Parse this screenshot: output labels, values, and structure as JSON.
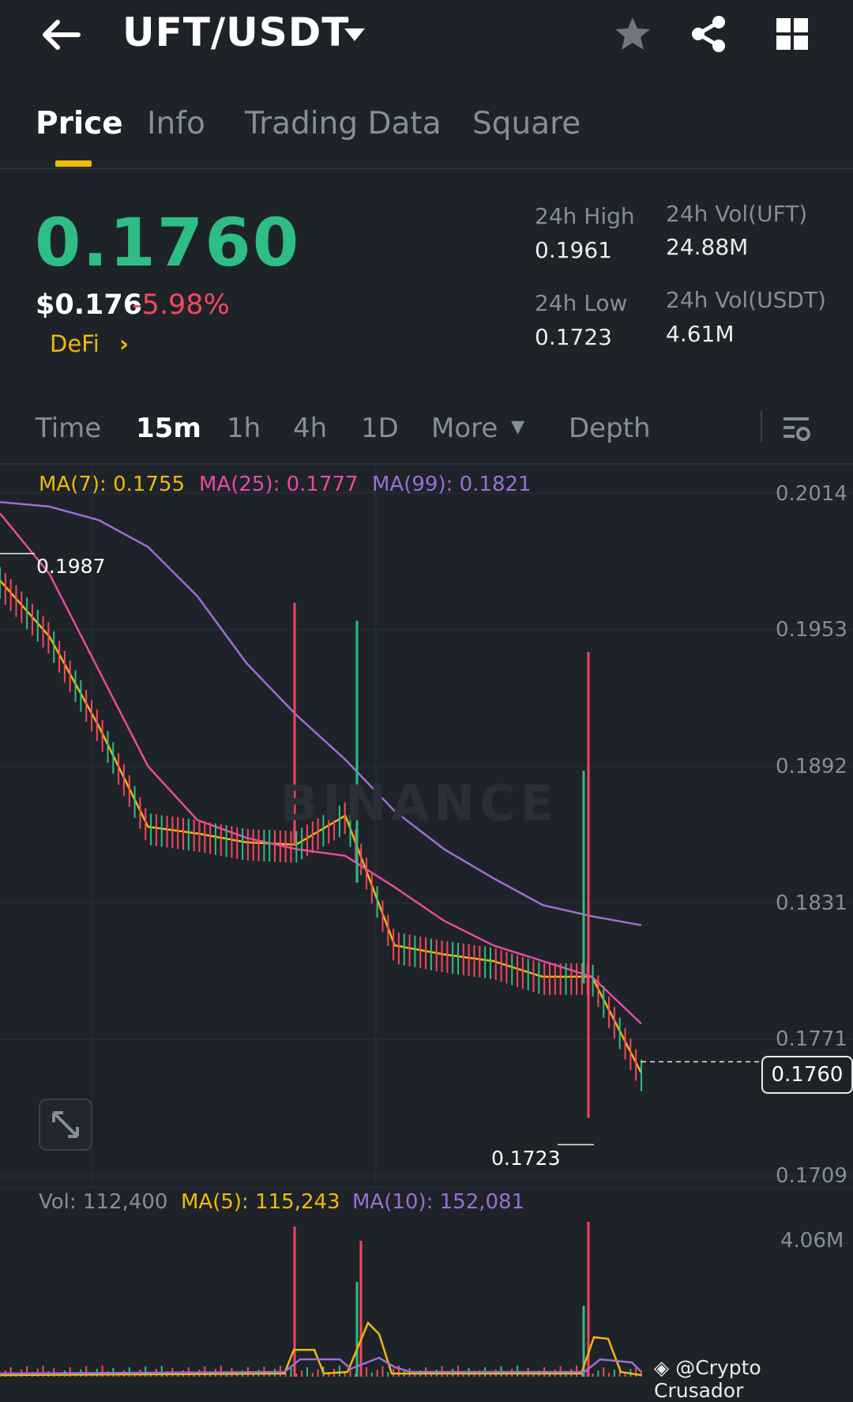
{
  "header": {
    "pair": "UFT/USDT",
    "icons": [
      "back-arrow-icon",
      "dropdown-caret-icon",
      "star-icon",
      "share-icon",
      "grid-icon"
    ]
  },
  "tabs": [
    "Price",
    "Info",
    "Trading Data",
    "Square"
  ],
  "active_tab": "Price",
  "price": {
    "last": "0.1760",
    "usd": "$0.176",
    "change": "-5.98%",
    "tag": "DeFi",
    "high_label": "24h High",
    "high": "0.1961",
    "low_label": "24h Low",
    "low": "0.1723",
    "vol_base_label": "24h Vol(UFT)",
    "vol_base": "24.88M",
    "vol_quote_label": "24h Vol(USDT)",
    "vol_quote": "4.61M"
  },
  "intervals": {
    "items": [
      "Time",
      "15m",
      "1h",
      "4h",
      "1D",
      "More",
      "Depth"
    ],
    "active": "15m"
  },
  "indicators": {
    "ma7": "MA(7): 0.1755",
    "ma25": "MA(25): 0.1777",
    "ma99": "MA(99): 0.1821"
  },
  "y_axis": [
    "0.2014",
    "0.1953",
    "0.1892",
    "0.1831",
    "0.1771",
    "0.1709"
  ],
  "markers": {
    "high": "0.1987",
    "low": "0.1723",
    "current": "0.1760"
  },
  "watermark": "BINANCE",
  "volume": {
    "vol": "Vol: 112,400",
    "ma5": "MA(5): 115,243",
    "ma10": "MA(10): 152,081",
    "max_label": "4.06M"
  },
  "colors": {
    "up": "#2ebd85",
    "down": "#f6465d",
    "accent": "#f0b90b",
    "ma7": "#f0b90b",
    "ma25": "#e84aa4",
    "ma99": "#9b6fd3"
  },
  "credit": "@Crypto Crusador",
  "chart_data": {
    "type": "line",
    "note_series": [
      "MA(7)",
      "MA(25)",
      "MA(99)"
    ],
    "ylim": [
      0.1709,
      0.2014
    ],
    "x": [
      0,
      5,
      10,
      15,
      20,
      25,
      30,
      35,
      40,
      45,
      50,
      55,
      60,
      65
    ],
    "series": [
      {
        "name": "MA(7)",
        "values": [
          0.1975,
          0.195,
          0.191,
          0.1865,
          0.1862,
          0.1858,
          0.1857,
          0.187,
          0.1812,
          0.1808,
          0.1805,
          0.1798,
          0.1798,
          0.1755
        ]
      },
      {
        "name": "MA(25)",
        "values": [
          0.2005,
          0.1978,
          0.1935,
          0.1892,
          0.1868,
          0.186,
          0.1855,
          0.1852,
          0.1838,
          0.1823,
          0.1812,
          0.1805,
          0.1798,
          0.1777
        ]
      },
      {
        "name": "MA(99)",
        "values": [
          0.201,
          0.2008,
          0.2002,
          0.199,
          0.1968,
          0.1938,
          0.1915,
          0.1895,
          0.1872,
          0.1855,
          0.1842,
          0.183,
          0.1825,
          0.1821
        ]
      }
    ]
  }
}
